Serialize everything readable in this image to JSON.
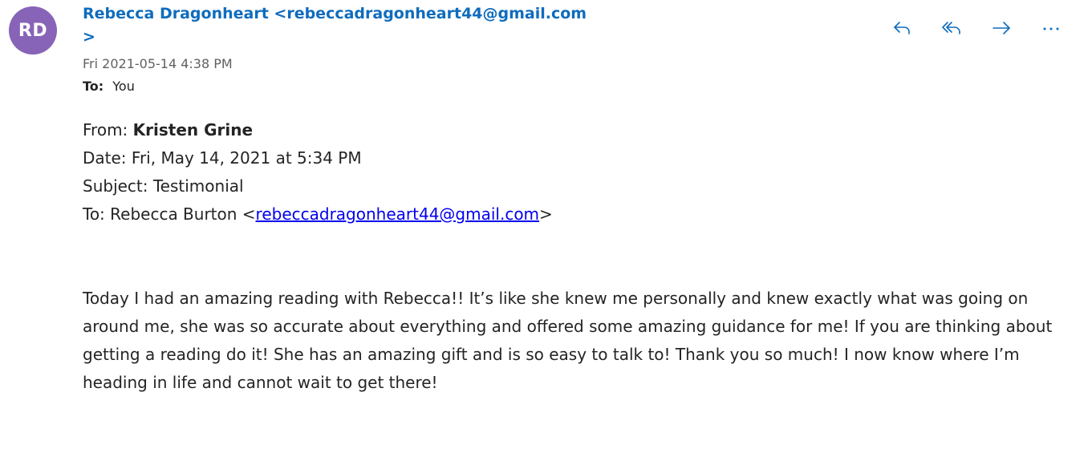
{
  "sender": {
    "initials": "RD",
    "display": "Rebecca Dragonheart <rebeccadragonheart44@gmail.com>",
    "avatar_color": "#8764b8"
  },
  "meta": {
    "date": "Fri 2021-05-14 4:38 PM",
    "to_label": "To:",
    "to_value": "You"
  },
  "actions": [
    {
      "name": "reply",
      "icon": "reply-icon"
    },
    {
      "name": "reply-all",
      "icon": "reply-all-icon"
    },
    {
      "name": "forward",
      "icon": "forward-icon"
    },
    {
      "name": "more",
      "icon": "more-icon"
    }
  ],
  "forwarded": {
    "from_label": "From:",
    "from_name": "Kristen Grine",
    "date_line": "Date: Fri, May 14, 2021 at 5:34 PM",
    "subject_line": "Subject: Testimonial",
    "to_prefix": "To: Rebecca Burton <",
    "to_email": "rebeccadragonheart44@gmail.com",
    "to_suffix": ">"
  },
  "body": {
    "text": "Today I had an amazing reading with Rebecca!! It’s like she knew me personally and knew exactly what was going on around me, she was so accurate about everything and offered some amazing guidance for me! If you are thinking about getting a reading do it! She has an amazing gift and is so easy to talk to! Thank you so much! I now know where I’m heading in life and cannot wait to get there!"
  },
  "colors": {
    "accent": "#0f6cbd",
    "link": "#0000ee",
    "text": "#242424",
    "muted": "#616161"
  }
}
